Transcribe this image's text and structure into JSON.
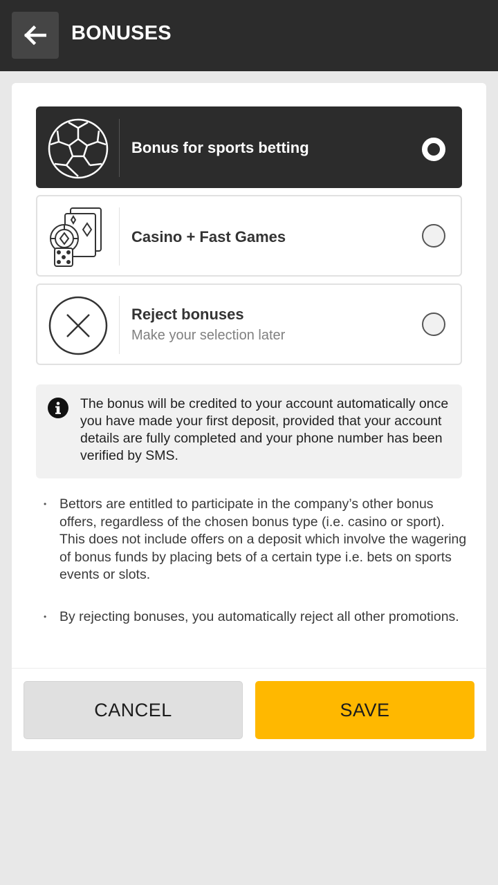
{
  "header": {
    "title": "BONUSES",
    "back_icon": "arrow-left-icon"
  },
  "options": [
    {
      "label": "Bonus for sports betting",
      "sublabel": "",
      "icon": "soccer-ball-icon",
      "selected": true
    },
    {
      "label": "Casino + Fast Games",
      "sublabel": "",
      "icon": "casino-cards-dice-icon",
      "selected": false
    },
    {
      "label": "Reject bonuses",
      "sublabel": "Make your selection later",
      "icon": "reject-x-icon",
      "selected": false
    }
  ],
  "info": {
    "icon": "info-icon",
    "text": "The bonus will be credited to your account automatically once you have made your first deposit, provided that your account details are fully completed and your phone number has been verified by SMS."
  },
  "notes": [
    "Bettors are entitled to participate in the company’s other bonus offers, regardless of the chosen bonus type (i.e. casino or sport). This does not include offers on a deposit which involve the wagering of bonus funds by placing bets of a certain type i.e. bets on sports events or slots.",
    "By rejecting bonuses, you automatically reject all other promotions."
  ],
  "buttons": {
    "cancel_label": "CANCEL",
    "save_label": "SAVE"
  },
  "colors": {
    "header_bg": "#2c2c2c",
    "accent": "#ffb800",
    "selected_option_bg": "#2c2c2c",
    "page_bg": "#e8e8e8"
  }
}
